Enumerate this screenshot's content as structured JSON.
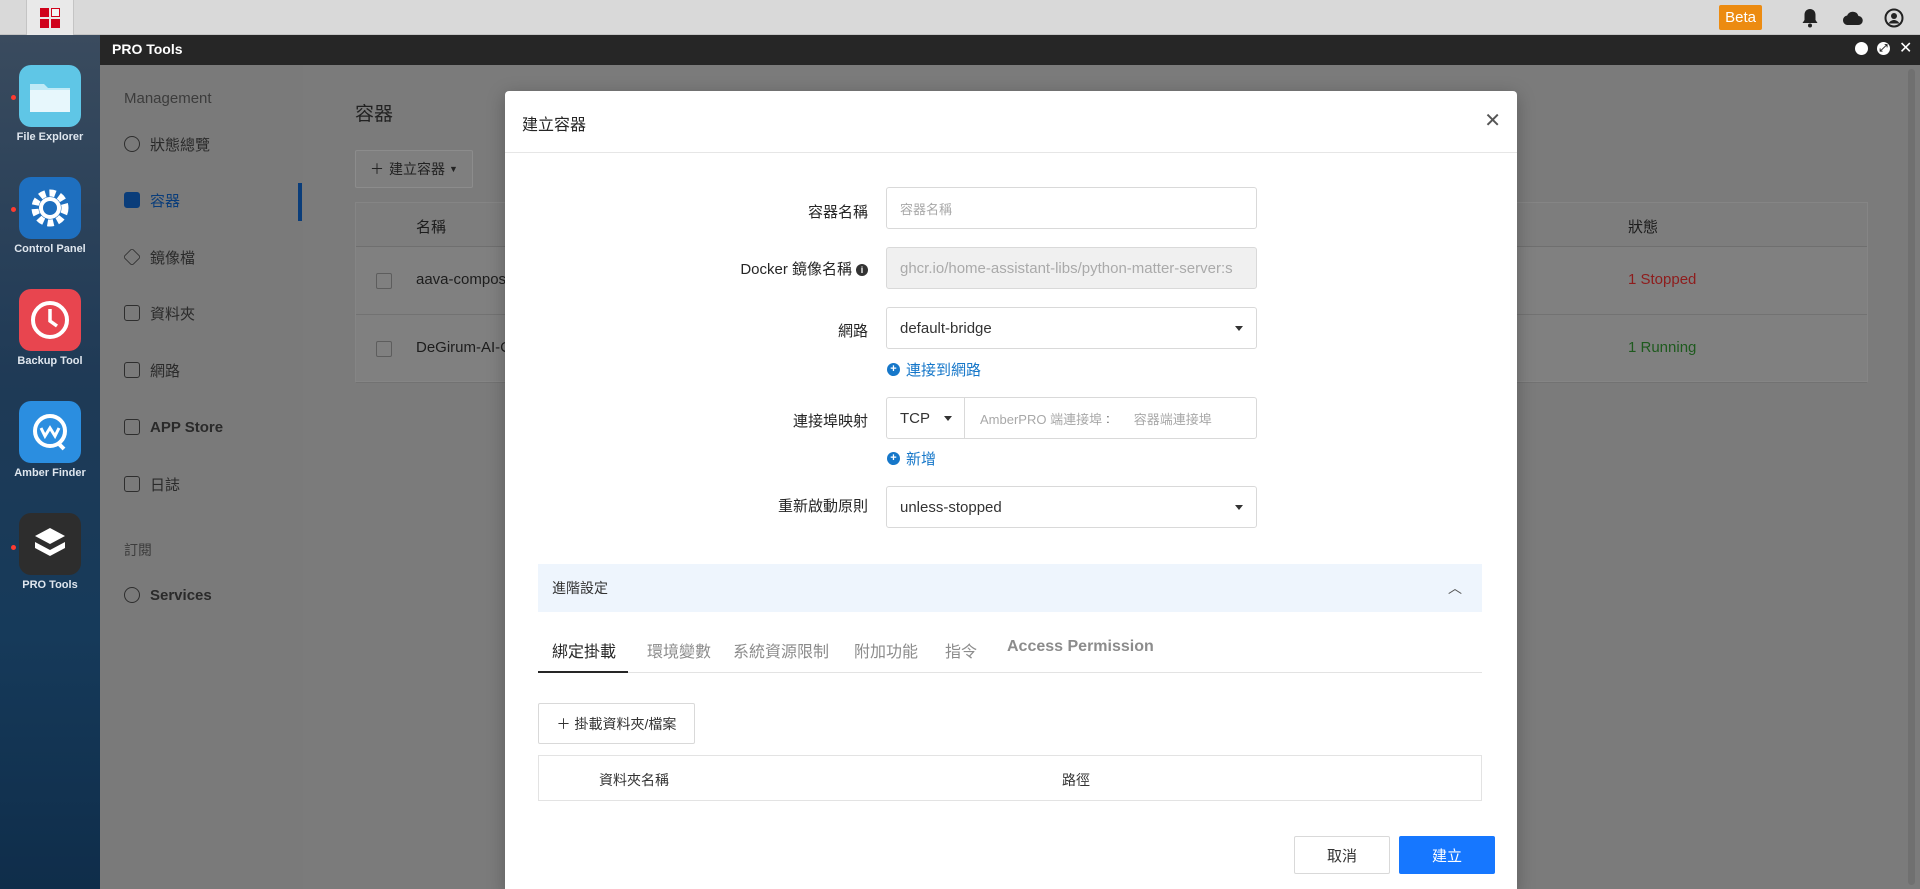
{
  "taskbar": {
    "beta_label": "Beta"
  },
  "dock": {
    "items": [
      {
        "label": "File Explorer"
      },
      {
        "label": "Control Panel"
      },
      {
        "label": "Backup Tool"
      },
      {
        "label": "Amber Finder"
      },
      {
        "label": "PRO Tools"
      }
    ]
  },
  "window": {
    "title": "PRO Tools"
  },
  "sidebar": {
    "section_management": "Management",
    "items": [
      {
        "label": "狀態總覽"
      },
      {
        "label": "容器"
      },
      {
        "label": "鏡像檔"
      },
      {
        "label": "資料夾"
      },
      {
        "label": "網路"
      },
      {
        "label": "APP Store"
      },
      {
        "label": "日誌"
      }
    ],
    "section_subscribe": "訂閱",
    "services_label": "Services"
  },
  "content": {
    "title": "容器",
    "create_button": "建立容器",
    "table": {
      "col_name": "名稱",
      "col_status": "狀態",
      "rows": [
        {
          "name": "aava-compos",
          "status": "1 Stopped"
        },
        {
          "name": "DeGirum-AI-C",
          "status": "1 Running"
        }
      ]
    }
  },
  "modal": {
    "title": "建立容器",
    "fields": {
      "name_label": "容器名稱",
      "name_placeholder": "容器名稱",
      "image_label": "Docker 鏡像名稱",
      "image_value": "ghcr.io/home-assistant-libs/python-matter-server:s",
      "network_label": "網路",
      "network_value": "default-bridge",
      "connect_network_link": "連接到網路",
      "port_label": "連接埠映射",
      "port_protocol": "TCP",
      "host_port_placeholder": "AmberPRO 端連接埠",
      "port_separator": ":",
      "container_port_placeholder": "容器端連接埠",
      "add_link": "新增",
      "restart_label": "重新啟動原則",
      "restart_value": "unless-stopped"
    },
    "advanced": {
      "label": "進階設定",
      "tabs": [
        "綁定掛載",
        "環境變數",
        "系統資源限制",
        "附加功能",
        "指令",
        "Access Permission"
      ],
      "mount_button": "掛載資料夾/檔案",
      "col_folder": "資料夾名稱",
      "col_path": "路徑"
    },
    "cancel_label": "取消",
    "submit_label": "建立"
  }
}
